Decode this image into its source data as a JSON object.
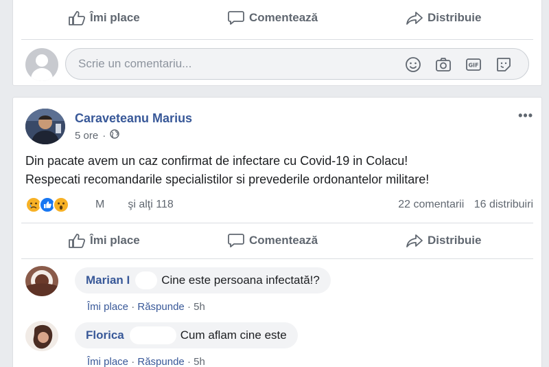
{
  "top_post": {
    "actions": {
      "like": "Îmi place",
      "comment": "Comentează",
      "share": "Distribuie"
    },
    "compose": {
      "placeholder": "Scrie un comentariu..."
    },
    "compose_icons": [
      "smiley-icon",
      "camera-icon",
      "gif-icon",
      "sticker-icon"
    ]
  },
  "post": {
    "author": "Caraveteanu Marius",
    "time": "5 ore",
    "separator": "·",
    "audience_icon": "globe-icon",
    "text_line1": "Din pacate avem un caz confirmat de infectare cu Covid-19 in Colacu!",
    "text_line2": "Respecati recomandarile specialistilor si prevederile ordonantelor militare!",
    "reactions": [
      "sad",
      "like",
      "wow"
    ],
    "reaction_summary_prefix": "M",
    "reaction_summary_suffix": "şi alţi 118",
    "comment_count": "22 comentarii",
    "share_count": "16 distribuiri",
    "actions": {
      "like": "Îmi place",
      "comment": "Comentează",
      "share": "Distribuie"
    }
  },
  "comments": [
    {
      "name": "Marian I",
      "text": "Cine este persoana infectată!?",
      "like": "Îmi place",
      "reply": "Răspunde",
      "time": "5h",
      "dot": "·"
    },
    {
      "name": "Florica",
      "text": "Cum aflam cine este",
      "like": "Îmi place",
      "reply": "Răspunde",
      "time": "5h",
      "dot": "·"
    }
  ],
  "colors": {
    "background": "#e9ebee",
    "link": "#385898",
    "secondary_text": "#606770",
    "like_blue": "#1877f2"
  }
}
